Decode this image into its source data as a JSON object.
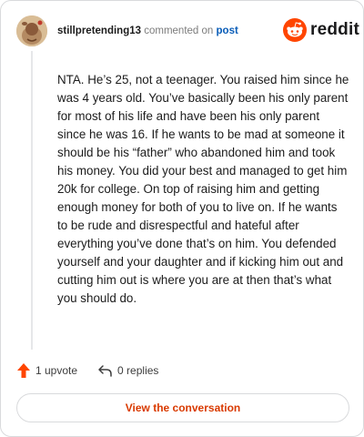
{
  "comment": {
    "username": "stillpretending13",
    "action_text": "commented on",
    "post_link": "post",
    "body": "NTA. He’s 25, not a teenager. You raised him since he was 4 years old. You’ve basically been his only parent for most of his life and have been his only parent since he was 16. If he wants to be mad at someone it should be his “father” who abandoned him and took his money. You did your best and managed to get him 20k for college. On top of raising him and getting enough money for both of you to live on. If he wants to be rude and disrespectful and hateful after everything you’ve done that’s on him. You defended yourself and your daughter and if kicking him out and cutting him out is where you are at then that’s what you should do."
  },
  "brand": {
    "name": "reddit",
    "accent": "#ff4500"
  },
  "actions": {
    "upvote_label": "1 upvote",
    "replies_label": "0 replies"
  },
  "cta": {
    "label": "View the conversation",
    "color": "#d93a00"
  },
  "icons": [
    "avatar",
    "reddit-logo-icon",
    "upvote-arrow-icon",
    "reply-arrow-icon"
  ]
}
